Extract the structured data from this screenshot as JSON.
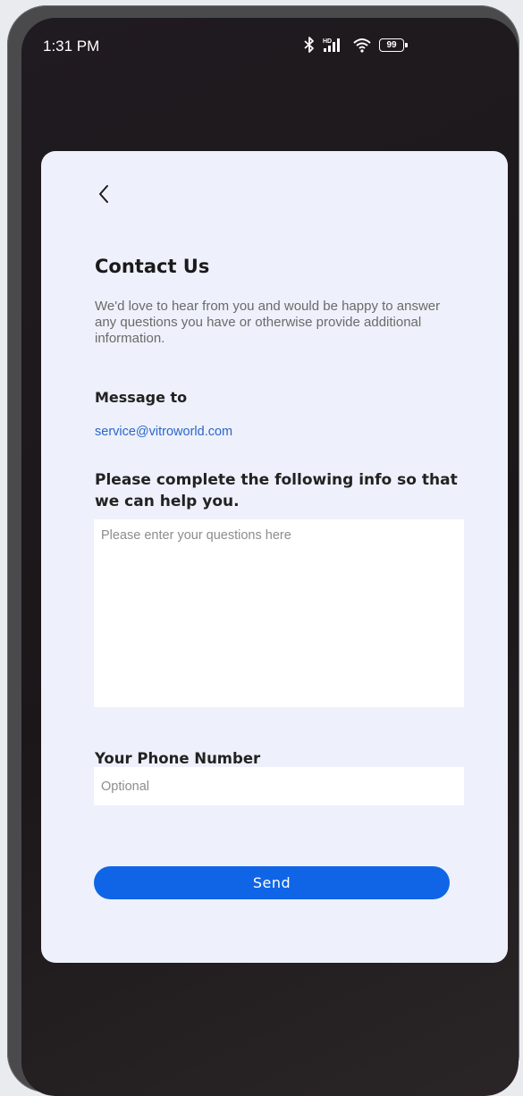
{
  "status_bar": {
    "time": "1:31 PM",
    "battery": "99",
    "icons": [
      "bluetooth-icon",
      "signal-icon",
      "wifi-icon",
      "battery-icon"
    ]
  },
  "contact": {
    "title": "Contact Us",
    "intro": "We'd love to hear from you and would be happy to answer any questions you have or otherwise provide additional information.",
    "message_to_label": "Message to",
    "email": "service@vitroworld.com",
    "complete_info_label": "Please complete the following info so that we can help you.",
    "questions_placeholder": "Please enter your questions here",
    "questions_value": "",
    "phone_label": "Your Phone Number",
    "phone_placeholder": "Optional",
    "phone_value": "",
    "send_label": "Send"
  },
  "colors": {
    "card_background": "#eef1fb",
    "accent": "#0f65e6",
    "link": "#2b66c8"
  }
}
